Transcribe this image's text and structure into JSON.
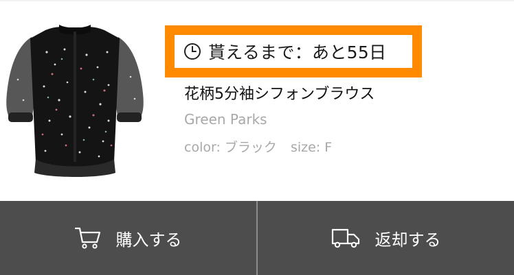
{
  "countdown": {
    "icon": "clock-icon",
    "text": "貰えるまで：あと55日",
    "border_color": "#ff8a00"
  },
  "product": {
    "name": "花柄5分袖シフォンブラウス",
    "brand": "Green Parks",
    "color_text": "color: ブラック",
    "size_text": "size: F",
    "image_desc_icon": "blouse-image"
  },
  "actions": {
    "purchase": {
      "icon": "cart-icon",
      "label": "購入する"
    },
    "return": {
      "icon": "delivery-truck-icon",
      "label": "返却する"
    },
    "background": "#4d4d4d"
  }
}
